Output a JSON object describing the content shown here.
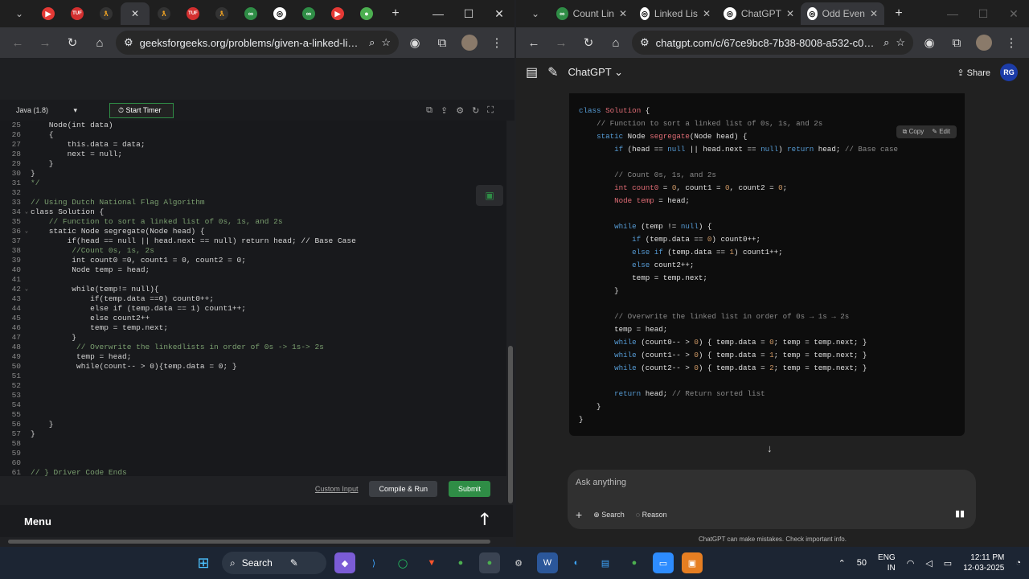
{
  "left_browser": {
    "tabs": [
      "",
      "",
      "",
      "",
      "",
      "",
      "",
      "",
      "",
      "",
      "",
      "",
      ""
    ],
    "active_tab_close": "✕",
    "url": "geeksforgeeks.org/problems/given-a-linked-list-o...",
    "editor": {
      "language": "Java (1.8)",
      "start_timer": "Start Timer",
      "lines": [
        {
          "n": "25",
          "code": "    Node(int data)"
        },
        {
          "n": "26",
          "code": "    {"
        },
        {
          "n": "27",
          "code": "        this.data = data;"
        },
        {
          "n": "28",
          "code": "        next = null;"
        },
        {
          "n": "29",
          "code": "    }"
        },
        {
          "n": "30",
          "code": "}"
        },
        {
          "n": "31",
          "code": "*/"
        },
        {
          "n": "32",
          "code": ""
        },
        {
          "n": "33",
          "code": "// Using Dutch National Flag Algorithm"
        },
        {
          "n": "34",
          "code": "class Solution {"
        },
        {
          "n": "35",
          "code": "    // Function to sort a linked list of 0s, 1s, and 2s"
        },
        {
          "n": "36",
          "code": "    static Node segregate(Node head) {"
        },
        {
          "n": "37",
          "code": "        if(head == null || head.next == null) return head; // Base Case"
        },
        {
          "n": "38",
          "code": "         //Count 0s, 1s, 2s"
        },
        {
          "n": "39",
          "code": "         int count0 =0, count1 = 0, count2 = 0;"
        },
        {
          "n": "40",
          "code": "         Node temp = head;"
        },
        {
          "n": "41",
          "code": ""
        },
        {
          "n": "42",
          "code": "         while(temp!= null){"
        },
        {
          "n": "43",
          "code": "             if(temp.data ==0) count0++;"
        },
        {
          "n": "44",
          "code": "             else if (temp.data == 1) count1++;"
        },
        {
          "n": "45",
          "code": "             else count2++"
        },
        {
          "n": "46",
          "code": "             temp = temp.next;"
        },
        {
          "n": "47",
          "code": "         }"
        },
        {
          "n": "48",
          "code": "          // Overwrite the linkedlists in order of 0s -> 1s-> 2s"
        },
        {
          "n": "49",
          "code": "          temp = head;"
        },
        {
          "n": "50",
          "code": "          while(count-- > 0){temp.data = 0; }"
        },
        {
          "n": "51",
          "code": ""
        },
        {
          "n": "52",
          "code": ""
        },
        {
          "n": "53",
          "code": ""
        },
        {
          "n": "54",
          "code": ""
        },
        {
          "n": "55",
          "code": ""
        },
        {
          "n": "56",
          "code": "    }"
        },
        {
          "n": "57",
          "code": "}"
        },
        {
          "n": "58",
          "code": ""
        },
        {
          "n": "59",
          "code": ""
        },
        {
          "n": "60",
          "code": ""
        },
        {
          "n": "61",
          "code": "// } Driver Code Ends"
        }
      ],
      "custom_input": "Custom Input",
      "compile_run": "Compile & Run",
      "submit": "Submit"
    },
    "menu_label": "Menu",
    "up_arrow": "🡑"
  },
  "right_browser": {
    "tabs": [
      {
        "label": "Count Lin"
      },
      {
        "label": "Linked Lis"
      },
      {
        "label": "ChatGPT"
      },
      {
        "label": "Odd Even"
      }
    ],
    "url": "chatgpt.com/c/67ce9bc8-7b38-8008-a532-c081ee...",
    "header": {
      "title": "ChatGPT ⌄",
      "share": "Share",
      "avatar": "RG"
    },
    "code_actions": {
      "copy": "Copy",
      "edit": "Edit"
    },
    "composer": {
      "placeholder": "Ask anything",
      "search": "Search",
      "reason": "Reason"
    },
    "disclaimer": "ChatGPT can make mistakes. Check important info."
  },
  "taskbar": {
    "search": "Search",
    "battery": "50",
    "lang_line1": "ENG",
    "lang_line2": "IN",
    "time": "12:11 PM",
    "date": "12-03-2025"
  }
}
